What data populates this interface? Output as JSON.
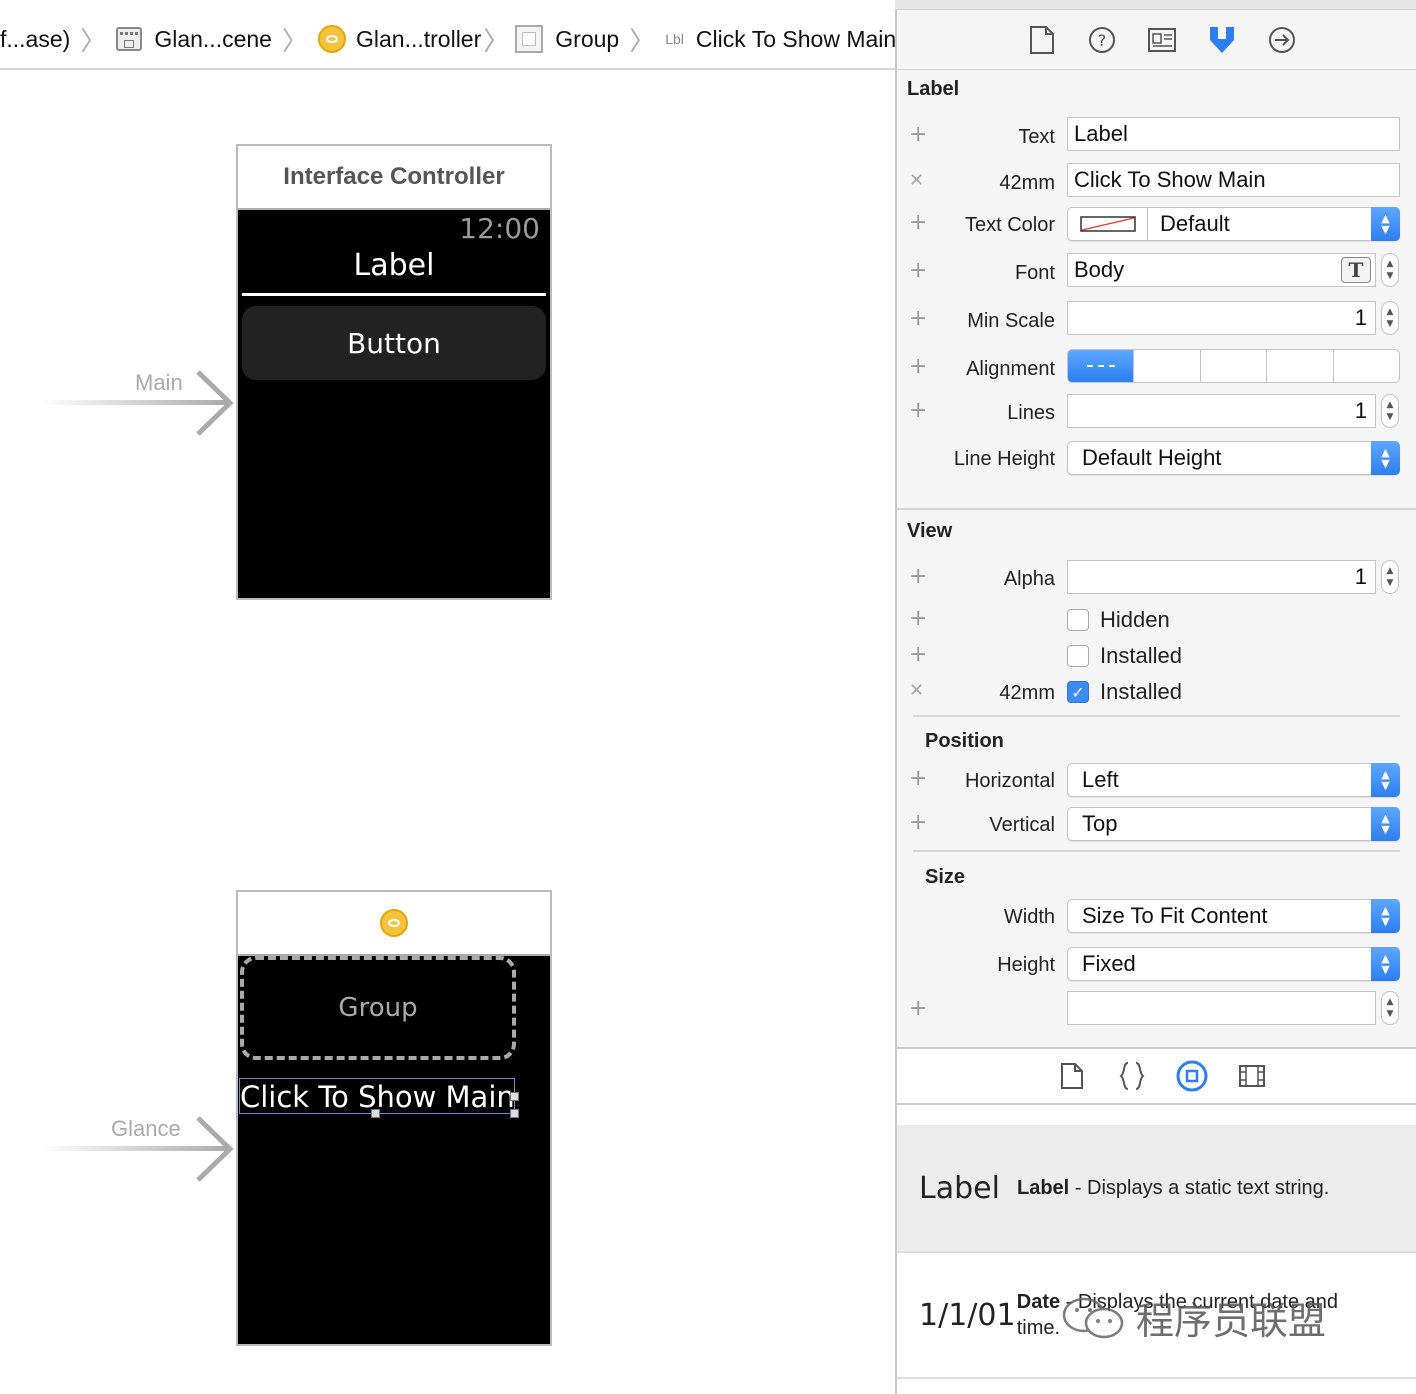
{
  "jumpbar": {
    "items": [
      {
        "label": "f...ase)"
      },
      {
        "label": "Glan...cene"
      },
      {
        "label": "Glan...troller"
      },
      {
        "label": "Group"
      },
      {
        "prefix": "Lbl",
        "label": "Click To Show Main"
      }
    ],
    "separator": "〉"
  },
  "main_scene": {
    "title": "Interface Controller",
    "time": "12:00",
    "label": "Label",
    "button": "Button",
    "entry": "Main"
  },
  "glance_scene": {
    "group": "Group",
    "selected_label": "Click To Show Main",
    "entry": "Glance"
  },
  "inspector": {
    "tabs": [
      "file-icon",
      "help-icon",
      "identity-icon",
      "attributes-icon",
      "connections-icon"
    ],
    "label_section": {
      "title": "Label",
      "text_label": "Text",
      "text_value": "Label",
      "variant_label": "42mm",
      "variant_value": "Click To Show Main",
      "text_color_label": "Text Color",
      "text_color_value": "Default",
      "font_label": "Font",
      "font_value": "Body",
      "min_scale_label": "Min Scale",
      "min_scale_value": "1",
      "alignment_label": "Alignment",
      "alignment_options": [
        "left",
        "center",
        "right",
        "justified",
        "natural"
      ],
      "alignment_selected": "left",
      "lines_label": "Lines",
      "lines_value": "1",
      "line_height_label": "Line Height",
      "line_height_value": "Default Height"
    },
    "view_section": {
      "title": "View",
      "alpha_label": "Alpha",
      "alpha_value": "1",
      "hidden_label": "Hidden",
      "hidden_checked": false,
      "installed_label": "Installed",
      "installed_checked": false,
      "variant_label": "42mm",
      "variant_installed_label": "Installed",
      "variant_installed_checked": true,
      "check_mark": "✓"
    },
    "position_section": {
      "title": "Position",
      "horizontal_label": "Horizontal",
      "horizontal_value": "Left",
      "vertical_label": "Vertical",
      "vertical_value": "Top"
    },
    "size_section": {
      "title": "Size",
      "width_label": "Width",
      "width_value": "Size To Fit Content",
      "height_label": "Height",
      "height_value": "Fixed",
      "height_fixed_value": ""
    }
  },
  "library": {
    "tabs": [
      "file-template-icon",
      "code-snippet-icon",
      "object-library-icon",
      "media-library-icon"
    ],
    "selected_tab": "object-library-icon",
    "items": [
      {
        "big": "Label",
        "name": "Label",
        "desc": " - Displays a static text string."
      },
      {
        "big": "1/1/01",
        "name": "Date",
        "desc": " - Displays the current date and time."
      }
    ]
  },
  "watermark": "程序员联盟",
  "colors": {
    "accent": "#2d7ff0",
    "watch_bg": "#000000",
    "controller_icon": "#f5c33b"
  }
}
